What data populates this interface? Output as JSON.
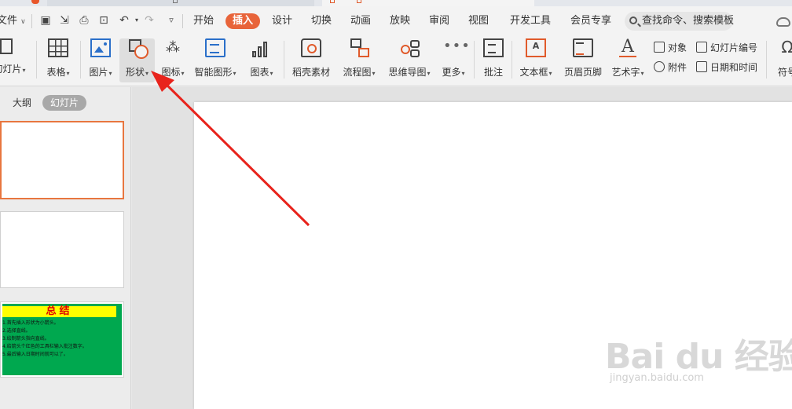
{
  "menubar": {
    "file_label": "文件",
    "tabs": [
      {
        "label": "开始"
      },
      {
        "label": "插入"
      },
      {
        "label": "设计"
      },
      {
        "label": "切换"
      },
      {
        "label": "动画"
      },
      {
        "label": "放映"
      },
      {
        "label": "审阅"
      },
      {
        "label": "视图"
      },
      {
        "label": "开发工具"
      },
      {
        "label": "会员专享"
      }
    ],
    "search_placeholder": "查找命令、搜索模板"
  },
  "ribbon": {
    "new_slide": "幻灯片",
    "table": "表格",
    "picture": "图片",
    "shape": "形状",
    "icon": "图标",
    "smartart": "智能图形",
    "chart": "图表",
    "material": "稻壳素材",
    "flowchart": "流程图",
    "mindmap": "思维导图",
    "more": "更多",
    "comment": "批注",
    "textbox": "文本框",
    "header_footer": "页眉页脚",
    "wordart": "艺术字",
    "object": "对象",
    "slide_number": "幻灯片编号",
    "attachment": "附件",
    "datetime": "日期和时间",
    "symbol": "符号"
  },
  "leftpane": {
    "tab_outline": "大纲",
    "tab_slides": "幻灯片",
    "slide3": {
      "title": "总结",
      "lines": [
        "1.首先插入形状为小箭头。",
        "2.选择直线。",
        "3.绘制箭头指向直线。",
        "4.给箭头个红色的工具栏输入批注数字。",
        "5.最后输入日期时间就可以了。"
      ]
    }
  },
  "watermark": {
    "brand": "Bai du 经验",
    "url": "jingyan.baidu.com"
  },
  "colors": {
    "accent": "#e8643a",
    "arrow": "#e8231c",
    "slide_green": "#00a84f",
    "slide_title_bg": "#ffff00"
  }
}
